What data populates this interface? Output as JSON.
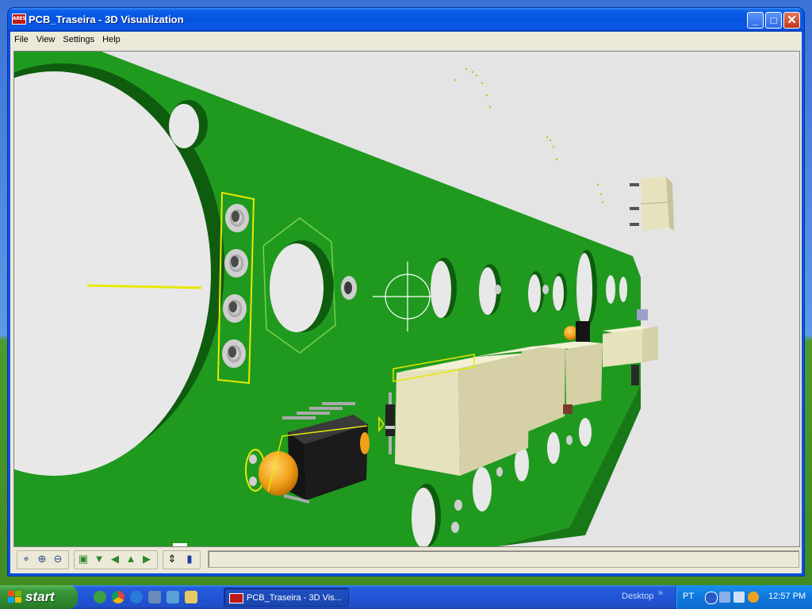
{
  "window": {
    "title": "PCB_Traseira - 3D Visualization",
    "app_icon_text": "ARES",
    "controls": {
      "minimize": "_",
      "maximize": "□",
      "close": "✕"
    }
  },
  "menu": {
    "items": [
      {
        "label": "File"
      },
      {
        "label": "View"
      },
      {
        "label": "Settings"
      },
      {
        "label": "Help"
      }
    ]
  },
  "toolbar": {
    "tools": [
      {
        "name": "pan-icon",
        "glyph": "⌖"
      },
      {
        "name": "zoom-in-icon",
        "glyph": "⊕"
      },
      {
        "name": "zoom-out-icon",
        "glyph": "⊖"
      },
      {
        "name": "view-top-icon",
        "glyph": "▣"
      },
      {
        "name": "view-bottom-icon",
        "glyph": "▼"
      },
      {
        "name": "view-left-icon",
        "glyph": "◀"
      },
      {
        "name": "view-front-icon",
        "glyph": "▲"
      },
      {
        "name": "view-right-icon",
        "glyph": "▶"
      },
      {
        "name": "height-icon",
        "glyph": "⇕"
      },
      {
        "name": "component-icon",
        "glyph": "▮"
      }
    ]
  },
  "taskbar": {
    "start_label": "start",
    "task_button": "PCB_Traseira - 3D Vis...",
    "desktop_label": "Desktop",
    "chevron": "»",
    "language": "PT",
    "clock": "12:57 PM"
  },
  "colors": {
    "board_green": "#1f9a1f",
    "silkscreen_yellow": "#e8e800",
    "relay_body": "#e6e2bd",
    "chip_black": "#1b1b1b",
    "capacitor_orange": "#f2a018"
  }
}
